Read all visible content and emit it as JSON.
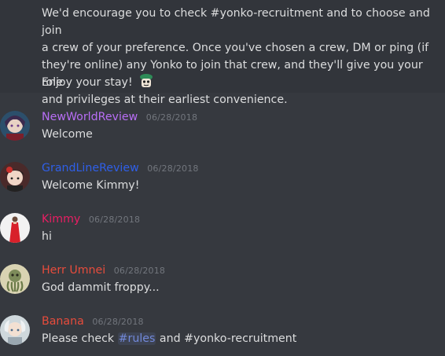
{
  "top_message": {
    "text": "We'd encourage you to check #yonko-recruitment and to choose and join\na crew of your preference. Once you've chosen a crew, DM or ping (if\nthey're online) any Yonko to join that crew, and they'll give you your role\nand privileges at their earliest convenience.",
    "enjoy": "Enjoy your stay!",
    "emoji": "frog-emoji"
  },
  "messages": [
    {
      "author": "NewWorldReview",
      "author_color": "#b86ef5",
      "timestamp": "06/28/2018",
      "text": "Welcome",
      "avatar": "anime-character-avatar-1"
    },
    {
      "author": "GrandLineReview",
      "author_color": "#2f5fe8",
      "timestamp": "06/28/2018",
      "text": "Welcome Kimmy!",
      "avatar": "anime-character-avatar-2"
    },
    {
      "author": "Kimmy",
      "author_color": "#e91e63",
      "timestamp": "06/28/2018",
      "text": "hi",
      "avatar": "red-dress-avatar"
    },
    {
      "author": "Herr Umnei",
      "author_color": "#e74c3c",
      "timestamp": "06/28/2018",
      "text": "God dammit froppy...",
      "avatar": "octopus-avatar"
    },
    {
      "author": "Banana",
      "author_color": "#e74c3c",
      "timestamp": "06/28/2018",
      "text_prefix": "Please check ",
      "mention": "#rules",
      "text_suffix": " and #yonko-recruitment",
      "avatar": "anime-character-avatar-3"
    }
  ]
}
